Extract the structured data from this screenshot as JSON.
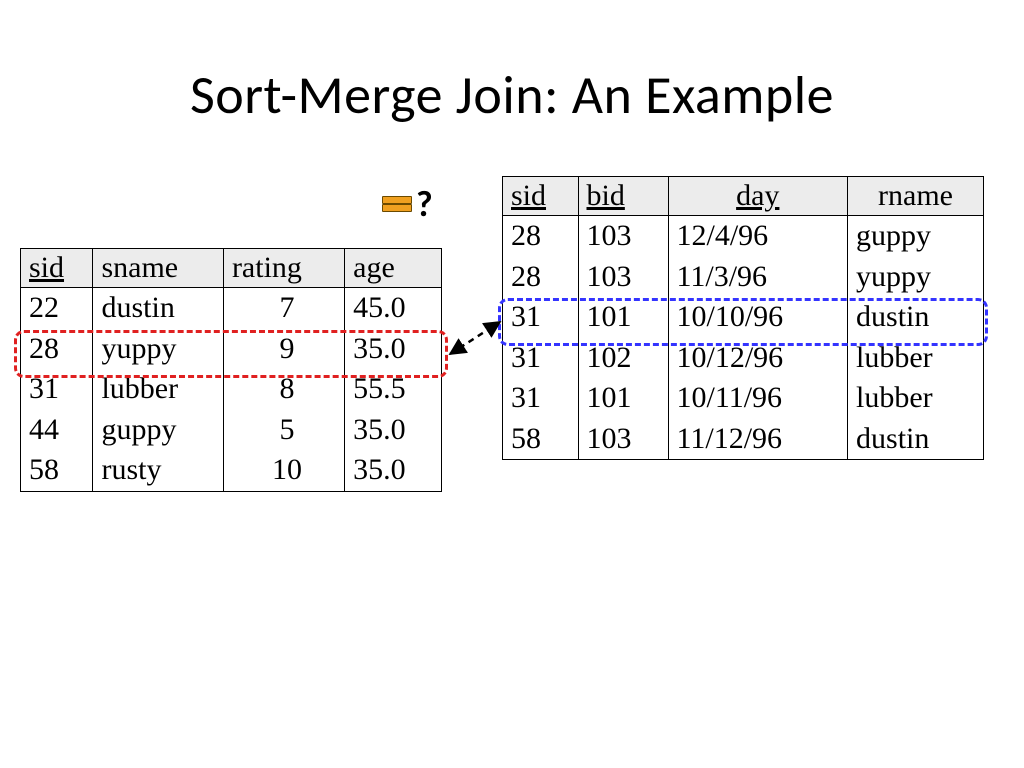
{
  "title": "Sort-Merge Join: An Example",
  "question_label": "?",
  "left": {
    "headers": {
      "sid": "sid",
      "sname": "sname",
      "rating": "rating",
      "age": "age"
    },
    "rows": [
      {
        "sid": "22",
        "sname": "dustin",
        "rating": "7",
        "age": "45.0"
      },
      {
        "sid": "28",
        "sname": "yuppy",
        "rating": "9",
        "age": "35.0"
      },
      {
        "sid": "31",
        "sname": "lubber",
        "rating": "8",
        "age": "55.5"
      },
      {
        "sid": "44",
        "sname": "guppy",
        "rating": "5",
        "age": "35.0"
      },
      {
        "sid": "58",
        "sname": "rusty",
        "rating": "10",
        "age": "35.0"
      }
    ]
  },
  "right": {
    "headers": {
      "sid": "sid",
      "bid": "bid",
      "day": "day",
      "rname": "rname"
    },
    "rows": [
      {
        "sid": "28",
        "bid": "103",
        "day": "12/4/96",
        "rname": "guppy"
      },
      {
        "sid": "28",
        "bid": "103",
        "day": "11/3/96",
        "rname": "yuppy"
      },
      {
        "sid": "31",
        "bid": "101",
        "day": "10/10/96",
        "rname": "dustin"
      },
      {
        "sid": "31",
        "bid": "102",
        "day": "10/12/96",
        "rname": "lubber"
      },
      {
        "sid": "31",
        "bid": "101",
        "day": "10/11/96",
        "rname": "lubber"
      },
      {
        "sid": "58",
        "bid": "103",
        "day": "11/12/96",
        "rname": "dustin"
      }
    ]
  },
  "highlights": {
    "left_row_index": 1,
    "right_row_index": 2,
    "colors": {
      "left": "#e02020",
      "right": "#3434ff"
    }
  }
}
